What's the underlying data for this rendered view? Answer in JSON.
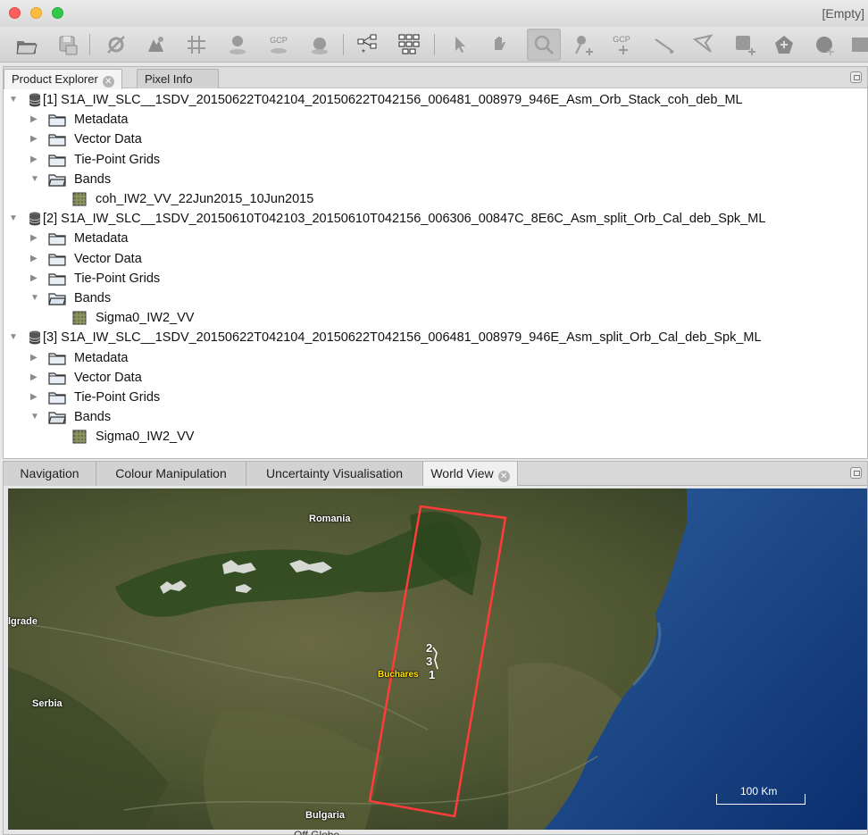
{
  "window": {
    "title": "[Empty]"
  },
  "product_explorer": {
    "tabs": [
      {
        "label": "Product Explorer",
        "active": true,
        "closable": true
      },
      {
        "label": "Pixel Info",
        "active": false,
        "closable": false
      }
    ],
    "products": [
      {
        "label": "[1] S1A_IW_SLC__1SDV_20150622T042104_20150622T042156_006481_008979_946E_Asm_Orb_Stack_coh_deb_ML",
        "groups": [
          "Metadata",
          "Vector Data",
          "Tie-Point Grids",
          "Bands"
        ],
        "bands": [
          "coh_IW2_VV_22Jun2015_10Jun2015"
        ]
      },
      {
        "label": "[2] S1A_IW_SLC__1SDV_20150610T042103_20150610T042156_006306_00847C_8E6C_Asm_split_Orb_Cal_deb_Spk_ML",
        "groups": [
          "Metadata",
          "Vector Data",
          "Tie-Point Grids",
          "Bands"
        ],
        "bands": [
          "Sigma0_IW2_VV"
        ]
      },
      {
        "label": "[3] S1A_IW_SLC__1SDV_20150622T042104_20150622T042156_006481_008979_946E_Asm_split_Orb_Cal_deb_Spk_ML",
        "groups": [
          "Metadata",
          "Vector Data",
          "Tie-Point Grids",
          "Bands"
        ],
        "bands": [
          "Sigma0_IW2_VV"
        ]
      }
    ]
  },
  "bottom_tabs": [
    {
      "label": "Navigation",
      "active": false
    },
    {
      "label": "Colour Manipulation",
      "active": false
    },
    {
      "label": "Uncertainty Visualisation",
      "active": false
    },
    {
      "label": "World View",
      "active": true,
      "closable": true
    }
  ],
  "world_view": {
    "labels": {
      "romania": "Romania",
      "belgrade": "lgrade",
      "serbia": "Serbia",
      "bucharest": "Buchares",
      "bulgaria": "Bulgaria"
    },
    "stack_numbers": [
      "2",
      "3",
      "1"
    ],
    "scale_label": "100 Km",
    "off_globe": "Off Globe",
    "footprint_color": "#ff3b3b"
  },
  "toolbar_icons": [
    "open-product-icon",
    "save-product-icon",
    "gear-off-icon",
    "geo-icon",
    "grid-icon",
    "pin-icon",
    "gcp-icon",
    "gcp-shape-icon",
    "graph-builder-icon",
    "batch-graph-icon",
    "select-tool-icon",
    "pan-tool-icon",
    "zoom-tool-icon",
    "pin-placing-icon",
    "gcp-placing-icon",
    "line-draw-icon",
    "polygon-draw-icon",
    "rectangle-draw-icon",
    "new-vector-icon",
    "range-finder-icon",
    "more-tool-icon"
  ]
}
